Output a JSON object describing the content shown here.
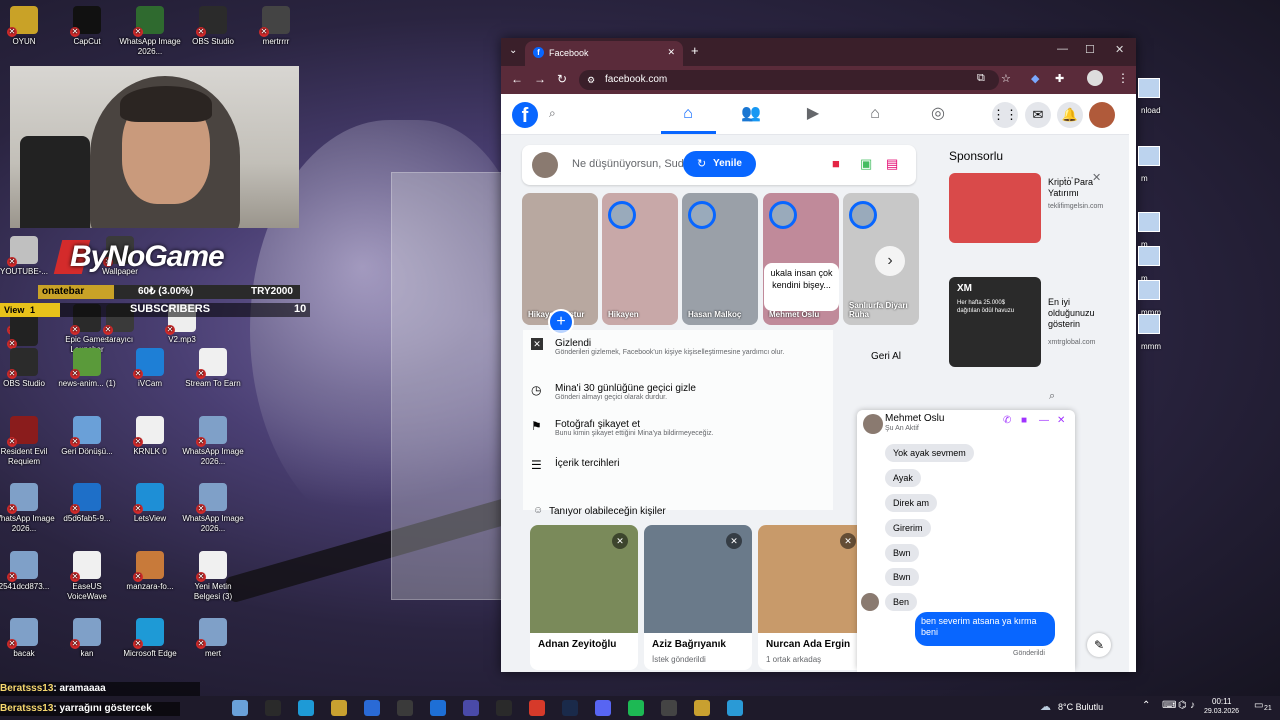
{
  "desktop_icons": [
    {
      "label": "OYUN",
      "x": "",
      "color": "#c9a227"
    },
    {
      "label": "CapCut",
      "color": "#111111"
    },
    {
      "label": "WhatsApp Image 2026...",
      "color": "#2f6a2f"
    },
    {
      "label": "OBS Studio",
      "color": "#2b2b2b"
    },
    {
      "label": "mertrrrr",
      "color": "#444444"
    },
    {
      "label": "YOUTUBE-...",
      "color": "#c0c0c0"
    },
    {
      "label": "Epic Games Launcher",
      "color": "#2a2a2a"
    },
    {
      "label": "V2.mp3",
      "color": "#eeeeee"
    },
    {
      "label": "AMD",
      "color": "#222222"
    },
    {
      "label": "View",
      "color": "#222222"
    },
    {
      "label": "OBS Studio",
      "color": "#2b2b2b"
    },
    {
      "label": "news-anim... (1)",
      "color": "#5a9a3a"
    },
    {
      "label": "iVCam",
      "color": "#1e7fd6"
    },
    {
      "label": "Stream To Earn",
      "color": "#f0f0f0"
    },
    {
      "label": "Resident Evil Requiem",
      "color": "#8a1c1c"
    },
    {
      "label": "Geri Dönüşü...",
      "color": "#6aa0d8"
    },
    {
      "label": "KRNLK 0",
      "color": "#f0f0f0"
    },
    {
      "label": "WhatsApp Image 2026...",
      "color": "#7fa0c8"
    },
    {
      "label": "WhatsApp Image 2026...",
      "color": "#7fa0c8"
    },
    {
      "label": "d5d6fab5-9...",
      "color": "#1e6fc8"
    },
    {
      "label": "LetsView",
      "color": "#1e8fd6"
    },
    {
      "label": "WhatsApp Image 2026...",
      "color": "#7fa0c8"
    },
    {
      "label": "2541dcd873...",
      "color": "#7fa0c8"
    },
    {
      "label": "EaseUS VoiceWave",
      "color": "#f0f0f0"
    },
    {
      "label": "manzara-fo...",
      "color": "#c87a3a"
    },
    {
      "label": "Yeni Metin Belgesi (3)",
      "color": "#f0f0f0"
    },
    {
      "label": "bacak",
      "color": "#7fa0c8"
    },
    {
      "label": "kan",
      "color": "#7fa0c8"
    },
    {
      "label": "Microsoft Edge",
      "color": "#1e9ad6"
    },
    {
      "label": "mert",
      "color": "#7fa0c8"
    },
    {
      "label": "tarayıcı",
      "color": "#3a3a3a"
    },
    {
      "label": "Wallpaper",
      "color": "#3a3a3a"
    }
  ],
  "stream_overlay": {
    "name": "ByNoGame",
    "donate_label": "onatebar",
    "donate_progress": "60₺ (3.00%)",
    "donate_goal": "TRY2000",
    "view_label": "View",
    "view_count": "1",
    "subscribers_label": "SUBSCRIBERS",
    "subscribers_count": "10",
    "chat_1_user": "Beratsss13",
    "chat_1_text": ": aramaaaa",
    "chat_2_user": "Beratsss13",
    "chat_2_text": ": yarrağını göstercek"
  },
  "browser": {
    "tab_title": "Facebook",
    "url": "facebook.com",
    "accent": "#0866ff"
  },
  "facebook": {
    "composer_placeholder": "Ne düşünüyorsun, Sud",
    "refresh_label": "Yenile",
    "sponsored_title": "Sponsorlu",
    "stories": [
      {
        "label": "Hikaye Oluştur",
        "color": "#b8a8a0"
      },
      {
        "label": "Hikayen",
        "color": "#c8a8a8"
      },
      {
        "label": "Hasan Malkoç",
        "color": "#9aa0a8"
      },
      {
        "label": "Mehmet Oslu",
        "color": "#c08a9a"
      },
      {
        "label": "Şanlıurfa Diyarı Ruha",
        "color": "#c8c8c8"
      }
    ],
    "story_bubble": "ukala insan çok kendini bişey...",
    "hide_menu": [
      {
        "title": "Gizlendi",
        "sub": "Gönderileri gizlemek, Facebook'un kişiye kişiselleştirmesine yardımcı olur."
      },
      {
        "title": "Mina'i 30 günlüğüne geçici gizle",
        "sub": "Gönderi almayı geçici olarak durdur."
      },
      {
        "title": "Fotoğrafı şikayet et",
        "sub": "Bunu kimin şikayet ettiğini Mina'ya bildirmeyeceğiz."
      },
      {
        "title": "İçerik tercihleri",
        "sub": ""
      }
    ],
    "undo_label": "Geri Al",
    "people_title": "Tanıyor olabileceğin kişiler",
    "people": [
      {
        "name": "Adnan Zeyitoğlu",
        "sub": "",
        "color": "#7a8a5a"
      },
      {
        "name": "Aziz Bağrıyanık",
        "sub": "İstek gönderildi",
        "color": "#6a7a8a"
      },
      {
        "name": "Nurcan Ada Ergin",
        "sub": "1 ortak arkadaş",
        "color": "#c89a6a"
      }
    ],
    "ads": [
      {
        "title": "Kripto Para Yatırımı",
        "url": "teklifimgelsin.com",
        "color": "#d94a4a"
      },
      {
        "title": "En iyi olduğunuzu gösterin",
        "url": "xmtrglobal.com",
        "color": "#2a2a2a"
      }
    ],
    "ad_xm_text": "XM",
    "ad_xm_line": "Her hafta 25.000$ dağıtılan ödül havuzu"
  },
  "chat": {
    "contact": "Mehmet Oslu",
    "status": "Şu An Aktif",
    "messages": [
      "Yok ayak sevmem",
      "Ayak",
      "Direk am",
      "Girerim",
      "Bwn",
      "Bwn",
      "Ben"
    ],
    "my_message": "ben severim atsana ya kırma beni",
    "sent_label": "Gönderildi",
    "input_placeholder": "Aa"
  },
  "taskbar": {
    "weather": "8°C Bulutlu",
    "time": "00:11",
    "date": "29.03.2026",
    "notif": "21"
  },
  "right_icons": [
    {
      "label": "nload"
    },
    {
      "label": "m"
    },
    {
      "label": "m"
    },
    {
      "label": "m"
    },
    {
      "label": "mmm"
    },
    {
      "label": "mmm"
    }
  ]
}
